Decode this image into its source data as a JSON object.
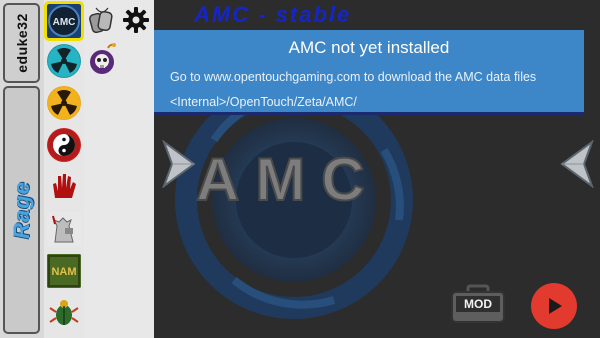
{
  "title": "AMC - stable",
  "tabs": [
    {
      "label": "eduke32"
    },
    {
      "label": "Rage"
    }
  ],
  "game_icons": [
    {
      "name": "AMC",
      "selected": true
    },
    {
      "name": "radiation-blue"
    },
    {
      "name": "radiation-yellow"
    },
    {
      "name": "yin-yang"
    },
    {
      "name": "blood-hand"
    },
    {
      "name": "dog"
    },
    {
      "name": "NAM"
    },
    {
      "name": "scarab"
    }
  ],
  "side_icons": [
    "dog-tags-icon",
    "gear-icon",
    "skull-bomb-icon"
  ],
  "banner": {
    "title": "AMC not yet installed",
    "line1": "Go to www.opentouchgaming.com to download the AMC data files",
    "line2": "<Internal>/OpenTouch/Zeta/AMC/"
  },
  "background_logo_text": "AMC",
  "mod_label": "MOD",
  "colors": {
    "banner": "#3d86c8",
    "title": "#1526c9",
    "play": "#e23a2e",
    "selection": "#f0e000"
  }
}
